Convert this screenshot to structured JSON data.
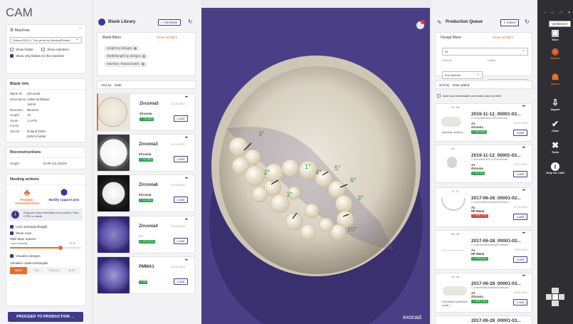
{
  "cam": {
    "title": "CAM",
    "machine_header": "Machine",
    "machine_select": "Roland 52DCI / Tool prefix by Medical/Roland",
    "show_holder": "Show holder",
    "show_cylinders": "Show cylinders",
    "show_only_blanks": "Show only blanks for this machine",
    "blank_info_header": "Blank info",
    "blank_info": [
      {
        "k": "Blank ID",
        "v": "Zirconia5"
      },
      {
        "k": "Description",
        "v": "Aidite Multilayer 16mm"
      },
      {
        "k": "",
        "v": ""
      },
      {
        "k": "Diameter",
        "v": "98.5mm"
      },
      {
        "k": "Height",
        "v": "16"
      },
      {
        "k": "Scale Factor",
        "v": "1.1475"
      },
      {
        "k": "Slot ID",
        "v": "Roland DWX-52DCI-holder"
      }
    ],
    "reconstructions_header": "Reconstructions",
    "height_label": "Height",
    "height_value": "13,96 (12,16)mm",
    "nesting_header": "Nesting actions",
    "position_label": "Position reconstructions",
    "modify_label": "Modify support pins",
    "hint_text": "Drag and drop restorations to position. Hold CTRL to rotate.",
    "lock_label": "Lock inclination/height",
    "show_axes": "Show Axes",
    "multi_layer": "Multi layer options",
    "layer_label": "Layer visibility",
    "layer_value": "71 %",
    "visualize_designs": "Visualize designs",
    "undercuts_label": "Visualize undercuts/angles",
    "undercut_tabs": [
      "None",
      "Top",
      "Bottom",
      "Both"
    ],
    "proceed_button": "PROCEED TO PRODUCTION"
  },
  "library": {
    "title": "Blank Library",
    "add_button": "+ Add blank",
    "filters_header": "Blank filters",
    "show_all_filters": "Show all filters",
    "chips": [
      "Height by designs",
      "Width/length by designs",
      "Machine: Roland 52DC"
    ],
    "sort_label": "Sort by:",
    "sort_value": "Date",
    "blanks": [
      {
        "name": "Zirconia5",
        "material": "Zirconia",
        "date": "21.06.2022",
        "tag": "✓ 14 | 82 |",
        "load": "Load"
      },
      {
        "name": "Zirconia3",
        "material": "Zirconia",
        "date": "04.11.2021",
        "tag": "✓ 14 | 82 |",
        "load": "Load"
      },
      {
        "name": "Zirconia6",
        "material": "Zirconia",
        "date": "11.08.2021",
        "tag": "✓ 14 | 82 |",
        "load": "Load"
      },
      {
        "name": "Zirconia4",
        "material": "A1",
        "date": "10.05.2019",
        "tag": "✓ 20 | 17.0 |",
        "load": "Load"
      },
      {
        "name": "PMMA1",
        "material": "",
        "date": "10.05.2019",
        "tag": "✓ 16",
        "load": "Load"
      }
    ]
  },
  "viewport": {
    "brand": "exocad",
    "angles": [
      "3°",
      "2°",
      "1°",
      "4°",
      "5°",
      "6°",
      "3°",
      "10°",
      "2°"
    ]
  },
  "queue": {
    "title": "Production Queue",
    "import_button": "Import",
    "filters_header": "Design filters",
    "show_all_filters": "Show all filters",
    "all_select": "All",
    "material_label": "Material",
    "material_value": "Any Material",
    "height_label": "Height",
    "height_value": "All",
    "sort_label": "Sort by:",
    "sort_value": "Date added",
    "auto_load": "Auto load machinable prenested parts by timer",
    "items": [
      {
        "num": "44..46",
        "name": "2019-11-12_00001-03...",
        "file": "C:\\exocad\\DM12.4\\Prod\\Exam...",
        "a": "A1",
        "date": "22.01.2020",
        "material": "Zirconia",
        "tag": "✓ 9.5 | 4.5 |",
        "red": false,
        "note": "(already nested)",
        "load": "Load"
      },
      {
        "num": "26",
        "name": "2019-11-12_00001-03...",
        "file": "C:\\exocad\\DM12.4\\Prod\\Exam...",
        "a": "A1",
        "date": "14.01.2020",
        "material": "Zirconia",
        "tag": "✓ 9.2 | 8 |",
        "red": false,
        "note": "",
        "load": "Load"
      },
      {
        "num": "17..27",
        "name": "2017-06-28_00001-02...",
        "file": "C:\\Users\\Rik\\Desktop\\Example...",
        "a": "A1",
        "date": "07.11.2019",
        "material": "NP Metal",
        "tag": "✓ 15.6 | 7.6 |",
        "red": true,
        "note": "",
        "load": "Load"
      },
      {
        "num": "36..46",
        "name": "2017-06-28_00001-02...",
        "file": "C:\\Users\\Rik\\Desktop\\Example...",
        "a": "A1",
        "date": "19.09.2019",
        "material": "NP Metal",
        "tag": "✓ 11.8 | 8.6 |",
        "red": false,
        "note": "",
        "load": "Load"
      },
      {
        "num": "44..46",
        "name": "2017-06-28_00001-03...",
        "file": "C:\\Users\\Rik\\Desktop\\Example...",
        "a": "A1",
        "date": "19.09.2019",
        "material": "Zirconia",
        "tag": "✓ 18.5 | 3.6 |",
        "red": false,
        "note": "Prenested (machine avail.)",
        "load": "Load"
      },
      {
        "num": "",
        "name": "2017-06-28_00001-03...",
        "file": "",
        "a": "",
        "date": "",
        "material": "",
        "tag": "",
        "red": false,
        "note": "",
        "load": ""
      }
    ]
  },
  "toolbar": {
    "tooltip": "Verkleinern",
    "tools": [
      {
        "label": "Save",
        "icon": "▣"
      },
      {
        "label": "Blanks",
        "icon": "◉"
      },
      {
        "label": "Queue",
        "icon": "☗"
      },
      {
        "label": "Import",
        "icon": "⇩"
      },
      {
        "label": "Clear",
        "icon": "✔"
      },
      {
        "label": "Tools",
        "icon": "✖"
      },
      {
        "label": "Help for CAM",
        "icon": "i"
      }
    ]
  }
}
